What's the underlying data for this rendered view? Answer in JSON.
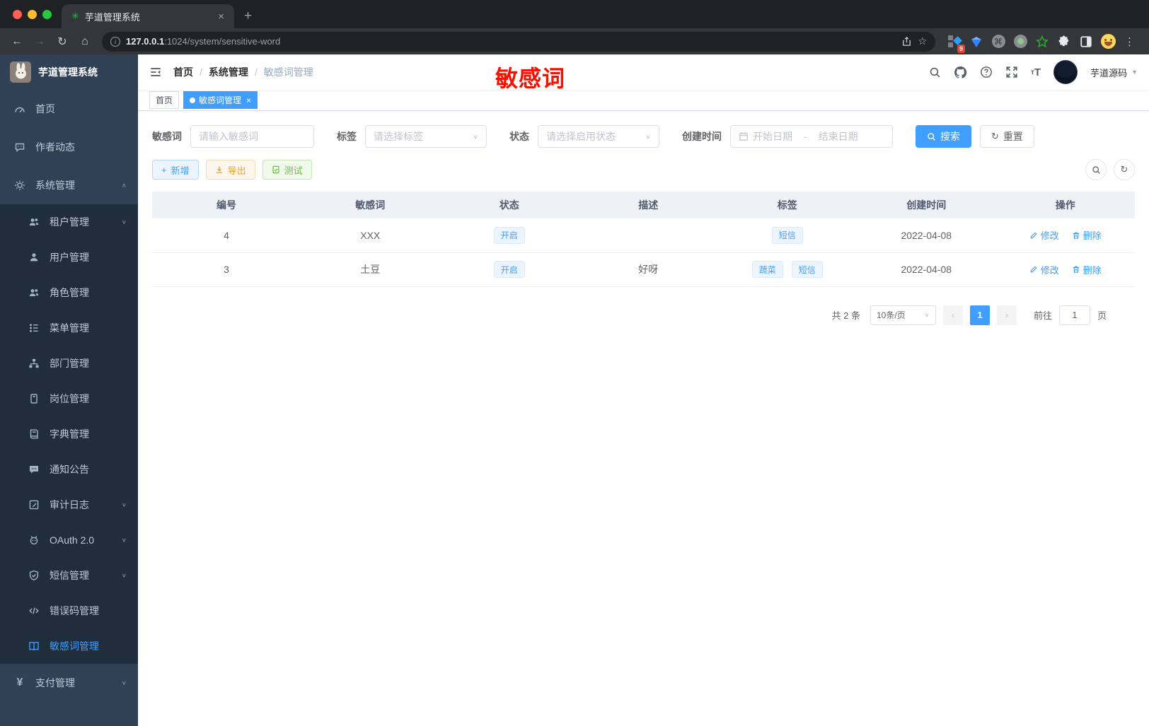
{
  "colors": {
    "accent": "#409eff",
    "warning": "#e6a23c",
    "success": "#67c23a",
    "annotation_red": "#f51000",
    "sidebar_bg": "#304156",
    "submenu_bg": "#1f2d3d"
  },
  "browser": {
    "tab_title": "芋道管理系统",
    "url_host": "127.0.0.1",
    "url_rest": ":1024/system/sensitive-word",
    "extension_badge": "9"
  },
  "sidebar": {
    "logo_title": "芋道管理系统",
    "items": [
      {
        "label": "首页"
      },
      {
        "label": "作者动态"
      },
      {
        "label": "系统管理"
      },
      {
        "label": "租户管理"
      },
      {
        "label": "用户管理"
      },
      {
        "label": "角色管理"
      },
      {
        "label": "菜单管理"
      },
      {
        "label": "部门管理"
      },
      {
        "label": "岗位管理"
      },
      {
        "label": "字典管理"
      },
      {
        "label": "通知公告"
      },
      {
        "label": "审计日志"
      },
      {
        "label": "OAuth 2.0"
      },
      {
        "label": "短信管理"
      },
      {
        "label": "错误码管理"
      },
      {
        "label": "敏感词管理"
      },
      {
        "label": "支付管理"
      }
    ]
  },
  "header": {
    "breadcrumb": {
      "home": "首页",
      "system": "系统管理",
      "current": "敏感词管理"
    },
    "annotation": "敏感词",
    "user_name": "芋道源码"
  },
  "tags": {
    "home": "首页",
    "current": "敏感词管理"
  },
  "filters": {
    "keyword_label": "敏感词",
    "keyword_placeholder": "请输入敏感词",
    "tag_label": "标签",
    "tag_placeholder": "请选择标签",
    "status_label": "状态",
    "status_placeholder": "请选择启用状态",
    "date_label": "创建时间",
    "date_start_placeholder": "开始日期",
    "date_separator": "-",
    "date_end_placeholder": "结束日期",
    "search_label": "搜索",
    "reset_label": "重置"
  },
  "toolbar": {
    "add_label": "新增",
    "export_label": "导出",
    "test_label": "测试"
  },
  "table": {
    "columns": {
      "id": "编号",
      "word": "敏感词",
      "status": "状态",
      "desc": "描述",
      "tags": "标签",
      "created": "创建时间",
      "actions": "操作"
    },
    "rows": [
      {
        "id": "4",
        "word": "XXX",
        "status": "开启",
        "desc": "",
        "tags": [
          "短信"
        ],
        "created": "2022-04-08"
      },
      {
        "id": "3",
        "word": "土豆",
        "status": "开启",
        "desc": "好呀",
        "tags": [
          "蔬菜",
          "短信"
        ],
        "created": "2022-04-08"
      }
    ],
    "edit_label": "修改",
    "delete_label": "删除"
  },
  "pagination": {
    "total": "共 2 条",
    "page_size": "10条/页",
    "current_page": "1",
    "goto_label": "前往",
    "goto_value": "1",
    "page_unit": "页"
  }
}
